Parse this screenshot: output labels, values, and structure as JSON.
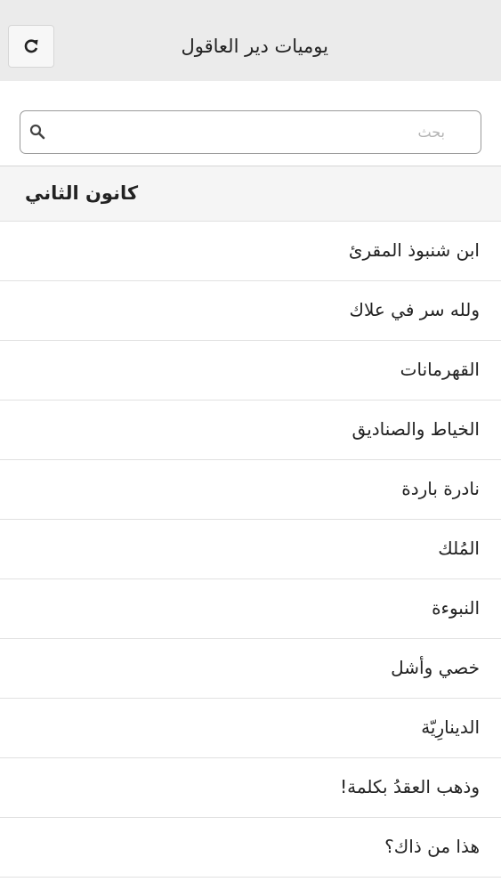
{
  "header": {
    "title": "يوميات دير العاقول",
    "refresh_icon": "refresh-icon"
  },
  "search": {
    "placeholder": "بحث",
    "value": "",
    "icon": "search-icon"
  },
  "section": {
    "title": "كانون الثاني"
  },
  "items": [
    {
      "label": "ابن شنبوذ المقرئ"
    },
    {
      "label": "ولله سر في علاك"
    },
    {
      "label": "القهرمانات"
    },
    {
      "label": "الخياط والصناديق"
    },
    {
      "label": "نادرة باردة"
    },
    {
      "label": "المُلك"
    },
    {
      "label": "النبوءة"
    },
    {
      "label": "خصي وأشل"
    },
    {
      "label": "الدينارِيّة"
    },
    {
      "label": "وذهب العقدُ بكلمة!"
    },
    {
      "label": "هذا من ذاك؟"
    }
  ]
}
